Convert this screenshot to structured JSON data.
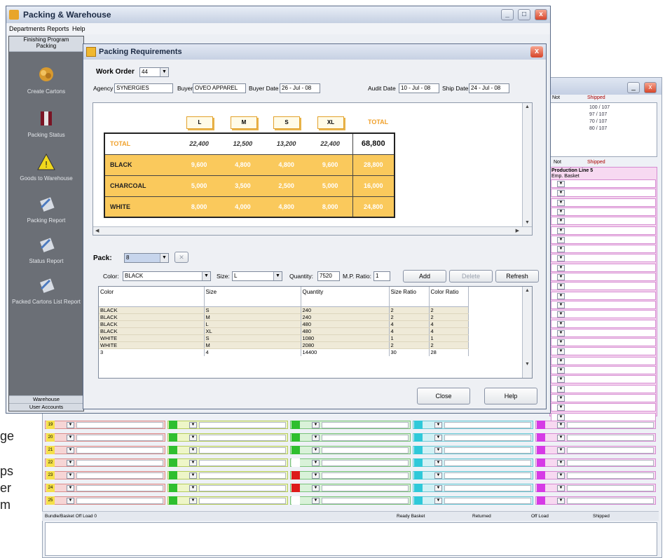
{
  "edge_text": [
    "ge",
    "ps",
    "er",
    "m"
  ],
  "window": {
    "title": "Packing & Warehouse"
  },
  "menu": [
    "Departments",
    "Reports",
    "Help"
  ],
  "left_panel": {
    "header1": "Finishing Program",
    "header2": "Packing",
    "items": [
      "Create Cartons",
      "Packing Status",
      "Goods to Warehouse",
      "Packing Report",
      "Status Report",
      "Packed Cartons List Report"
    ],
    "footer1": "Warehouse",
    "footer2": "User Accounts"
  },
  "dialog": {
    "title": "Packing Requirements",
    "work_order_label": "Work Order",
    "work_order_value": "44",
    "agency_label": "Agency",
    "agency_value": "SYNERGIES",
    "buyer_label": "Buyer",
    "buyer_value": "OVEO APPAREL",
    "buyer_date_label": "Buyer Date",
    "buyer_date_value": "26 - Jul - 08",
    "audit_date_label": "Audit Date",
    "audit_date_value": "10 - Jul - 08",
    "ship_date_label": "Ship Date",
    "ship_date_value": "24 - Jul - 08",
    "matrix": {
      "sizes": [
        "L",
        "M",
        "S",
        "XL"
      ],
      "total_label": "TOTAL",
      "rows": [
        {
          "name": "TOTAL",
          "values": [
            "22,400",
            "12,500",
            "13,200",
            "22,400"
          ],
          "total": "68,800"
        },
        {
          "name": "BLACK",
          "values": [
            "9,600",
            "4,800",
            "4,800",
            "9,600"
          ],
          "total": "28,800"
        },
        {
          "name": "CHARCOAL",
          "values": [
            "5,000",
            "3,500",
            "2,500",
            "5,000"
          ],
          "total": "16,000"
        },
        {
          "name": "WHITE",
          "values": [
            "8,000",
            "4,000",
            "4,800",
            "8,000"
          ],
          "total": "24,800"
        }
      ]
    },
    "pack_label": "Pack:",
    "pack_value": "8",
    "color_label": "Color:",
    "color_value": "BLACK",
    "size_label": "Size:",
    "size_value": "L",
    "quantity_label": "Quantity:",
    "quantity_value": "7520",
    "mp_ratio_label": "M.P. Ratio:",
    "mp_ratio_value": "1",
    "add_label": "Add",
    "delete_label": "Delete",
    "refresh_label": "Refresh",
    "grid": {
      "headers": [
        "Color",
        "Size",
        "Quantity",
        "Size Ratio",
        "Color Ratio"
      ],
      "rows": [
        [
          "BLACK",
          "S",
          "240",
          "2",
          "2"
        ],
        [
          "BLACK",
          "M",
          "240",
          "2",
          "2"
        ],
        [
          "BLACK",
          "L",
          "480",
          "4",
          "4"
        ],
        [
          "BLACK",
          "XL",
          "480",
          "4",
          "4"
        ],
        [
          "WHITE",
          "S",
          "1080",
          "1",
          "1"
        ],
        [
          "WHITE",
          "M",
          "2080",
          "2",
          "2"
        ]
      ],
      "footer": [
        "3",
        "4",
        "14400",
        "30",
        "28"
      ]
    },
    "close_label": "Close",
    "help_label": "Help"
  },
  "background": {
    "legend_labels": [
      "Not",
      "Shipped"
    ],
    "legend_rows": [
      "100 / 107",
      "97 / 107",
      "70 / 107",
      "80 / 107"
    ],
    "section_label": "Production Line 5",
    "section_cols": "Emp.  Basket",
    "bottom_title": "Bundle/Basket Off Load 0",
    "bottom_legend": [
      "Ready Basket",
      "Returned",
      "Off Load",
      "Shipped"
    ],
    "row_numbers": [
      "19",
      "20",
      "21",
      "22",
      "23",
      "24",
      "25"
    ],
    "colors": {
      "yellow": "#f5e04a",
      "green": "#2fbf2f",
      "red": "#dd1a1a",
      "cyan": "#2fc9d9",
      "magenta": "#d63be6"
    }
  }
}
